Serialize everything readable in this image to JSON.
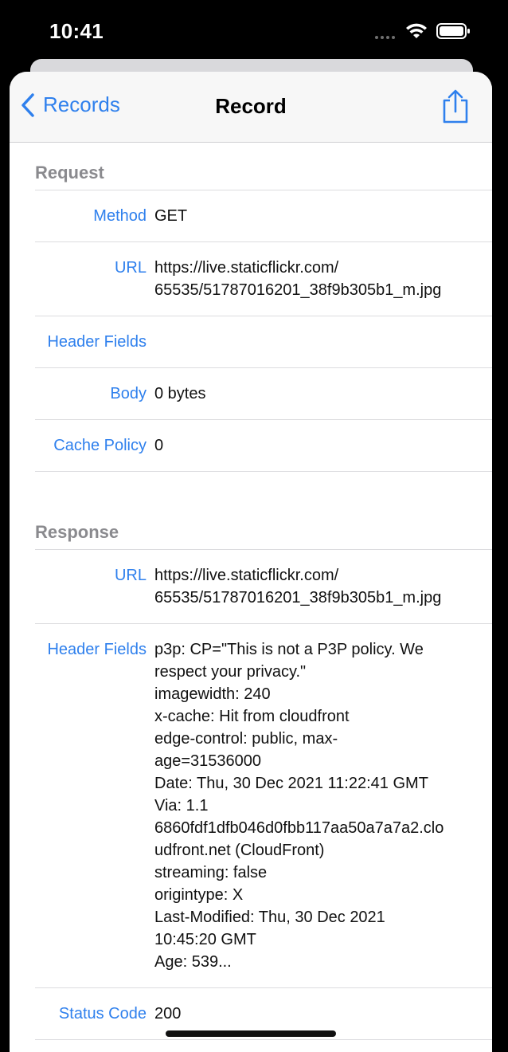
{
  "status_bar": {
    "time": "10:41"
  },
  "navbar": {
    "back_label": "Records",
    "title": "Record",
    "share_icon": "share-icon"
  },
  "request": {
    "header": "Request",
    "rows": [
      {
        "label": "Method",
        "value": [
          "GET"
        ]
      },
      {
        "label": "URL",
        "value": [
          "https://live.staticflickr.com/",
          "65535/51787016201_38f9b305b1_m.jpg"
        ]
      },
      {
        "label": "Header Fields",
        "value": [
          ""
        ]
      },
      {
        "label": "Body",
        "value": [
          "0 bytes"
        ]
      },
      {
        "label": "Cache Policy",
        "value": [
          "0"
        ]
      }
    ]
  },
  "response": {
    "header": "Response",
    "rows": [
      {
        "label": "URL",
        "value": [
          "https://live.staticflickr.com/",
          "65535/51787016201_38f9b305b1_m.jpg"
        ]
      },
      {
        "label": "Header Fields",
        "value": [
          "p3p: CP=\"This is not a P3P policy. We",
          "respect your privacy.\"",
          "imagewidth: 240",
          "x-cache: Hit from cloudfront",
          "edge-control: public, max-",
          "age=31536000",
          "Date: Thu, 30 Dec 2021 11:22:41 GMT",
          "Via: 1.1",
          "6860fdf1dfb046d0fbb117aa50a7a7a2.clo",
          "udfront.net (CloudFront)",
          "streaming: false",
          "origintype: X",
          "Last-Modified: Thu, 30 Dec 2021",
          "10:45:20 GMT",
          "Age: 539..."
        ]
      },
      {
        "label": "Status Code",
        "value": [
          "200"
        ]
      }
    ]
  },
  "colors": {
    "accent": "#2f80ed",
    "section_header": "#8a8a8e"
  }
}
